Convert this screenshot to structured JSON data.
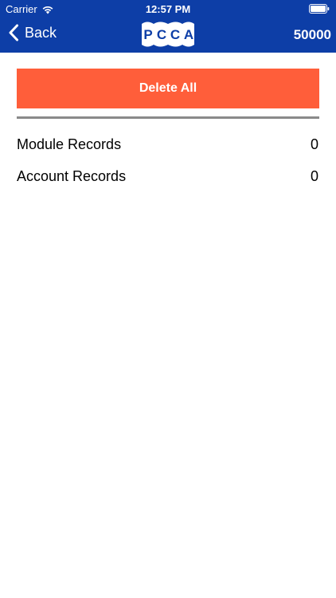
{
  "status_bar": {
    "carrier": "Carrier",
    "time": "12:57 PM"
  },
  "nav": {
    "back_label": "Back",
    "logo_letters": [
      "P",
      "C",
      "C",
      "A"
    ],
    "count": "50000"
  },
  "actions": {
    "delete_all_label": "Delete All"
  },
  "records": [
    {
      "label": "Module Records",
      "value": "0"
    },
    {
      "label": "Account Records",
      "value": "0"
    }
  ],
  "colors": {
    "header_bg": "#0d3ea7",
    "delete_button_bg": "#ff5e3a",
    "divider": "#8a8a8a"
  }
}
